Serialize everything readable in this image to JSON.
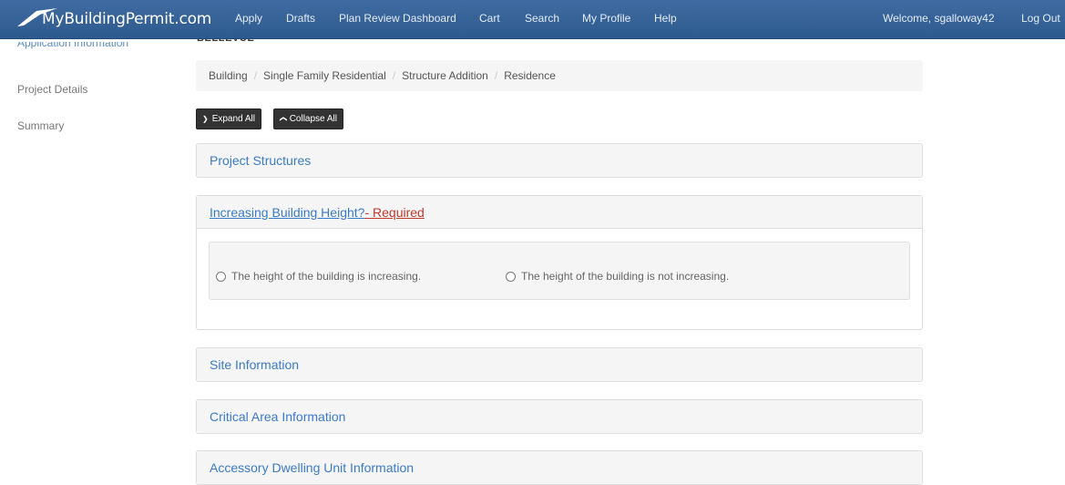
{
  "navbar": {
    "brand": "MyBuildingPermit.com",
    "items": [
      "Apply",
      "Drafts",
      "Plan Review Dashboard",
      "Cart",
      "Search",
      "My Profile",
      "Help"
    ],
    "welcome": "Welcome, sgalloway42",
    "logout": "Log Out"
  },
  "sidebar": {
    "items": [
      "Application Information",
      "Project Details",
      "Summary"
    ]
  },
  "page": {
    "city": "BELLEVUE"
  },
  "breadcrumb": [
    "Building",
    "Single Family Residential",
    "Structure Addition",
    "Residence"
  ],
  "buttons": {
    "expand_all": "Expand All",
    "collapse_all": "Collapse All"
  },
  "panels": {
    "project_structures": "Project Structures",
    "building_height": {
      "title": "Increasing Building Height?",
      "required": " - Required",
      "option_increasing": "The height of the building is increasing.",
      "option_not_increasing": "The height of the building is not increasing."
    },
    "site_information": "Site Information",
    "critical_area": "Critical Area Information",
    "adu": "Accessory Dwelling Unit Information"
  },
  "colors": {
    "navbar": "#2d5a8e",
    "link": "#3a7bc8",
    "required": "#c0392b"
  }
}
